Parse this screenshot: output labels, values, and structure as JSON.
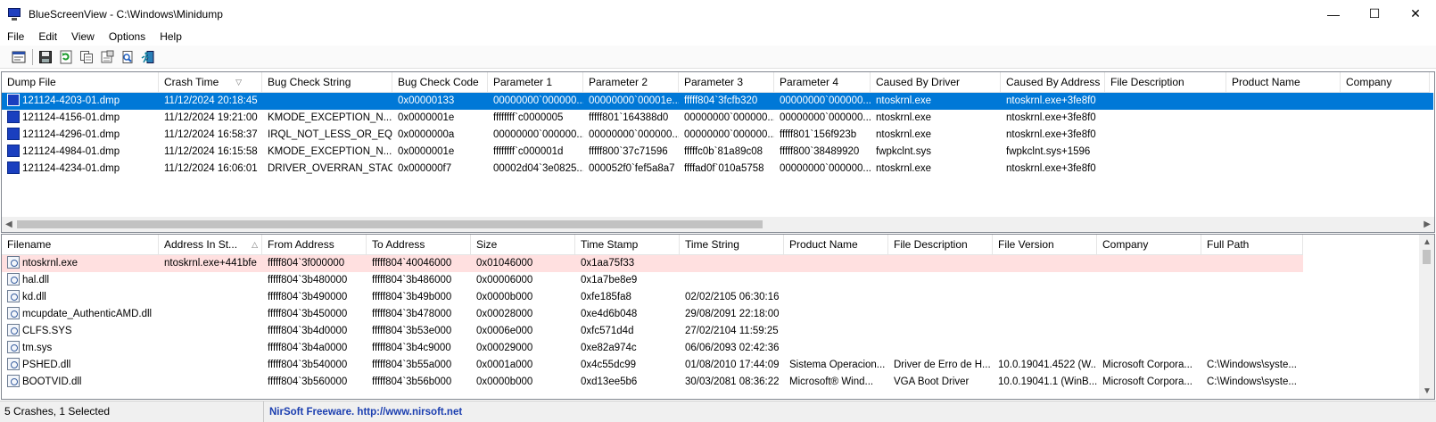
{
  "window": {
    "title": "BlueScreenView  -  C:\\Windows\\Minidump",
    "minimize_glyph": "—",
    "maximize_glyph": "☐",
    "close_glyph": "✕"
  },
  "menu": [
    "File",
    "Edit",
    "View",
    "Options",
    "Help"
  ],
  "toolbar_icons": [
    "properties-icon",
    "save-icon",
    "refresh-icon",
    "copy-icon",
    "html-report-icon",
    "find-icon",
    "exit-icon"
  ],
  "crash_list": {
    "columns": [
      "Dump File",
      "Crash Time",
      "Bug Check String",
      "Bug Check Code",
      "Parameter 1",
      "Parameter 2",
      "Parameter 3",
      "Parameter 4",
      "Caused By Driver",
      "Caused By Address",
      "File Description",
      "Product Name",
      "Company"
    ],
    "sort_indicator": "▽",
    "rows": [
      [
        "121124-4203-01.dmp",
        "11/12/2024 20:18:45",
        "",
        "0x00000133",
        "00000000`000000...",
        "00000000`00001e...",
        "fffff804`3fcfb320",
        "00000000`000000...",
        "ntoskrnl.exe",
        "ntoskrnl.exe+3fe8f0",
        "",
        "",
        ""
      ],
      [
        "121124-4156-01.dmp",
        "11/12/2024 19:21:00",
        "KMODE_EXCEPTION_N...",
        "0x0000001e",
        "ffffffff`c0000005",
        "fffff801`164388d0",
        "00000000`000000...",
        "00000000`000000...",
        "ntoskrnl.exe",
        "ntoskrnl.exe+3fe8f0",
        "",
        "",
        ""
      ],
      [
        "121124-4296-01.dmp",
        "11/12/2024 16:58:37",
        "IRQL_NOT_LESS_OR_EQ...",
        "0x0000000a",
        "00000000`000000...",
        "00000000`000000...",
        "00000000`000000...",
        "fffff801`156f923b",
        "ntoskrnl.exe",
        "ntoskrnl.exe+3fe8f0",
        "",
        "",
        ""
      ],
      [
        "121124-4984-01.dmp",
        "11/12/2024 16:15:58",
        "KMODE_EXCEPTION_N...",
        "0x0000001e",
        "ffffffff`c000001d",
        "fffff800`37c71596",
        "fffffc0b`81a89c08",
        "fffff800`38489920",
        "fwpkclnt.sys",
        "fwpkclnt.sys+1596",
        "",
        "",
        ""
      ],
      [
        "121124-4234-01.dmp",
        "11/12/2024 16:06:01",
        "DRIVER_OVERRAN_STAC...",
        "0x000000f7",
        "00002d04`3e0825...",
        "000052f0`fef5a8a7",
        "ffffad0f`010a5758",
        "00000000`000000...",
        "ntoskrnl.exe",
        "ntoskrnl.exe+3fe8f0",
        "",
        "",
        ""
      ]
    ],
    "selected_index": 0
  },
  "driver_list": {
    "columns": [
      "Filename",
      "Address In St...",
      "From Address",
      "To Address",
      "Size",
      "Time Stamp",
      "Time String",
      "Product Name",
      "File Description",
      "File Version",
      "Company",
      "Full Path"
    ],
    "sort_indicator": "△",
    "rows": [
      [
        "ntoskrnl.exe",
        "ntoskrnl.exe+441bfe",
        "fffff804`3f000000",
        "fffff804`40046000",
        "0x01046000",
        "0x1aa75f33",
        "",
        "",
        "",
        "",
        "",
        ""
      ],
      [
        "hal.dll",
        "",
        "fffff804`3b480000",
        "fffff804`3b486000",
        "0x00006000",
        "0x1a7be8e9",
        "",
        "",
        "",
        "",
        "",
        ""
      ],
      [
        "kd.dll",
        "",
        "fffff804`3b490000",
        "fffff804`3b49b000",
        "0x0000b000",
        "0xfe185fa8",
        "02/02/2105 06:30:16",
        "",
        "",
        "",
        "",
        ""
      ],
      [
        "mcupdate_AuthenticAMD.dll",
        "",
        "fffff804`3b450000",
        "fffff804`3b478000",
        "0x00028000",
        "0xe4d6b048",
        "29/08/2091 22:18:00",
        "",
        "",
        "",
        "",
        ""
      ],
      [
        "CLFS.SYS",
        "",
        "fffff804`3b4d0000",
        "fffff804`3b53e000",
        "0x0006e000",
        "0xfc571d4d",
        "27/02/2104 11:59:25",
        "",
        "",
        "",
        "",
        ""
      ],
      [
        "tm.sys",
        "",
        "fffff804`3b4a0000",
        "fffff804`3b4c9000",
        "0x00029000",
        "0xe82a974c",
        "06/06/2093 02:42:36",
        "",
        "",
        "",
        "",
        ""
      ],
      [
        "PSHED.dll",
        "",
        "fffff804`3b540000",
        "fffff804`3b55a000",
        "0x0001a000",
        "0x4c55dc99",
        "01/08/2010 17:44:09",
        "Sistema Operacion...",
        "Driver de Erro de H...",
        "10.0.19041.4522 (W...",
        "Microsoft Corpora...",
        "C:\\Windows\\syste..."
      ],
      [
        "BOOTVID.dll",
        "",
        "fffff804`3b560000",
        "fffff804`3b56b000",
        "0x0000b000",
        "0xd13ee5b6",
        "30/03/2081 08:36:22",
        "Microsoft® Wind...",
        "VGA Boot Driver",
        "10.0.19041.1 (WinB...",
        "Microsoft Corpora...",
        "C:\\Windows\\syste..."
      ]
    ],
    "highlight_index": 0
  },
  "status": {
    "count_text": "5 Crashes, 1 Selected",
    "link_text": "NirSoft Freeware.  http://www.nirsoft.net"
  },
  "colors": {
    "selection": "#0078d7",
    "highlight_row": "#ffe0e0",
    "link": "#1c3fb0"
  }
}
